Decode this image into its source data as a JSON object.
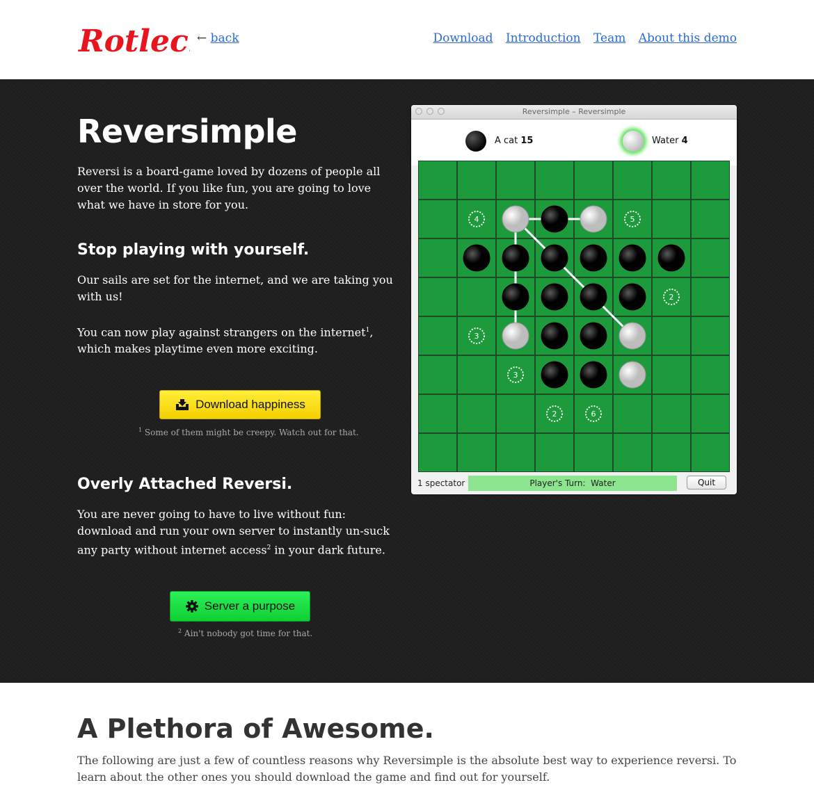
{
  "header": {
    "logo_text": "Rotlech",
    "back_arrow": "←",
    "back_label": "back",
    "nav": [
      "Download",
      "Introduction",
      "Team",
      "About this demo"
    ]
  },
  "hero": {
    "title": "Reversimple",
    "intro": "Reversi is a board-game loved by dozens of people all over the world. If you like fun, you are going to love what we have in store for you.",
    "h_online": "Stop playing with yourself.",
    "online_p1": "Our sails are set for the internet, and we are taking you with us!",
    "online_p2_before": "You can now play against strangers on the internet",
    "online_p2_sup": "1",
    "online_p2_after": ", which makes playtime even more exciting.",
    "download_button": "Download happiness",
    "note1_sup": "1",
    "note1": "Some of them might be creepy. Watch out for that.",
    "h_offline": "Overly Attached Reversi.",
    "offline_p_before": "You are never going to have to live without fun: download and run your own server to instantly un-suck any party without internet access",
    "offline_p_sup": "2",
    "offline_p_after": " in your dark future.",
    "server_button": "Server a purpose",
    "note2_sup": "2",
    "note2": "Ain't nobody got time for that."
  },
  "game": {
    "window_title": "Reversimple – Reversimple",
    "player1": {
      "name": "A cat",
      "score": "15",
      "color": "black"
    },
    "player2": {
      "name": "Water",
      "score": "4",
      "color": "white"
    },
    "spectators": "1 spectator",
    "turn_label": "Player's Turn:",
    "turn_player": "Water",
    "quit_button": "Quit",
    "board_color": "#1d9a3c",
    "pieces": [
      {
        "r": 1,
        "c": 2,
        "p": "w"
      },
      {
        "r": 1,
        "c": 3,
        "p": "b"
      },
      {
        "r": 1,
        "c": 4,
        "p": "w"
      },
      {
        "r": 2,
        "c": 1,
        "p": "b"
      },
      {
        "r": 2,
        "c": 2,
        "p": "b"
      },
      {
        "r": 2,
        "c": 3,
        "p": "b"
      },
      {
        "r": 2,
        "c": 4,
        "p": "b"
      },
      {
        "r": 2,
        "c": 5,
        "p": "b"
      },
      {
        "r": 2,
        "c": 6,
        "p": "b"
      },
      {
        "r": 3,
        "c": 2,
        "p": "b"
      },
      {
        "r": 3,
        "c": 3,
        "p": "b"
      },
      {
        "r": 3,
        "c": 4,
        "p": "b"
      },
      {
        "r": 3,
        "c": 5,
        "p": "b"
      },
      {
        "r": 4,
        "c": 2,
        "p": "w"
      },
      {
        "r": 4,
        "c": 3,
        "p": "b"
      },
      {
        "r": 4,
        "c": 4,
        "p": "b"
      },
      {
        "r": 4,
        "c": 5,
        "p": "w"
      },
      {
        "r": 5,
        "c": 3,
        "p": "b"
      },
      {
        "r": 5,
        "c": 4,
        "p": "b"
      },
      {
        "r": 5,
        "c": 5,
        "p": "w"
      }
    ],
    "hints": [
      {
        "r": 1,
        "c": 1,
        "n": "4"
      },
      {
        "r": 1,
        "c": 5,
        "n": "5"
      },
      {
        "r": 3,
        "c": 6,
        "n": "2"
      },
      {
        "r": 4,
        "c": 1,
        "n": "3"
      },
      {
        "r": 5,
        "c": 2,
        "n": "3"
      },
      {
        "r": 6,
        "c": 3,
        "n": "2"
      },
      {
        "r": 6,
        "c": 4,
        "n": "6"
      }
    ],
    "links": [
      [
        [
          1,
          2
        ],
        [
          1,
          4
        ]
      ],
      [
        [
          1,
          2
        ],
        [
          4,
          2
        ]
      ],
      [
        [
          1,
          2
        ],
        [
          4,
          5
        ]
      ]
    ]
  },
  "features": {
    "title": "A Plethora of Awesome.",
    "text": "The following are just a few of countless reasons why Reversimple is the absolute best way to experience reversi. To learn about the other ones you should download the game and find out for yourself."
  }
}
